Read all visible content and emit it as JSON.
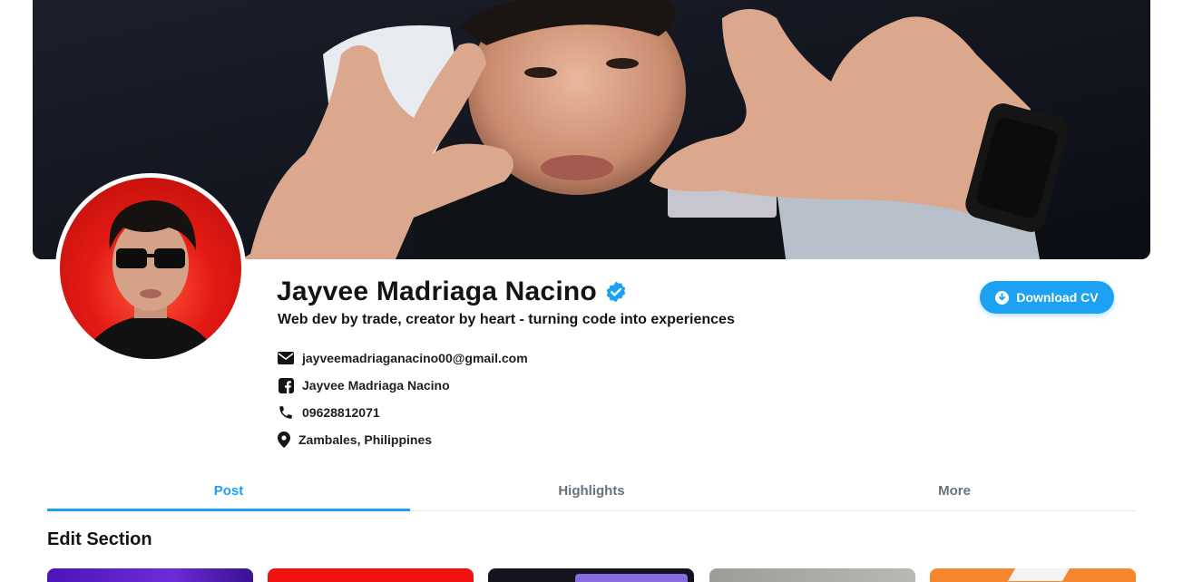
{
  "profile": {
    "name": "Jayvee Madriaga Nacino",
    "bio": "Web dev by trade, creator by heart - turning code into experiences",
    "verified_icon": "verified-badge-icon"
  },
  "contacts": [
    {
      "icon": "envelope-icon",
      "text": "jayveemadriaganacino00@gmail.com"
    },
    {
      "icon": "facebook-icon",
      "text": "Jayvee Madriaga Nacino"
    },
    {
      "icon": "phone-icon",
      "text": "09628812071"
    },
    {
      "icon": "map-pin-icon",
      "text": "Zambales, Philippines"
    }
  ],
  "actions": {
    "download_label": "Download CV",
    "download_icon": "download-circle-icon"
  },
  "tabs": [
    {
      "label": "Post",
      "active": true
    },
    {
      "label": "Highlights",
      "active": false
    },
    {
      "label": "More",
      "active": false
    }
  ],
  "section": {
    "title": "Edit Section"
  },
  "colors": {
    "accent": "#1da1f2",
    "tab_inactive": "#66727d",
    "avatar_bg": "#e41a14"
  }
}
